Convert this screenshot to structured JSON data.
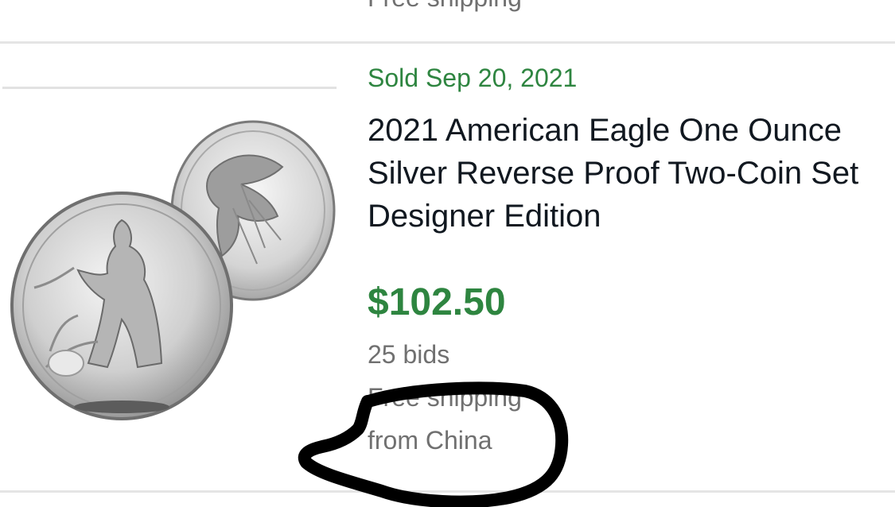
{
  "previous_listing": {
    "shipping": "Free shipping"
  },
  "listing": {
    "sold_date": "Sold Sep 20, 2021",
    "title": "2021 American Eagle One Ounce Silver Reverse Proof Two-Coin Set Designer Edition",
    "price": "$102.50",
    "bids": "25 bids",
    "shipping": "Free shipping",
    "location": "from China",
    "image_icon": "silver-eagle-coins-image"
  },
  "colors": {
    "sold_green": "#2e8540",
    "price_green": "#2e8540",
    "secondary_text": "#707070",
    "title_text": "#111820",
    "annotation_ink": "#000000",
    "divider": "#e5e5e5"
  }
}
